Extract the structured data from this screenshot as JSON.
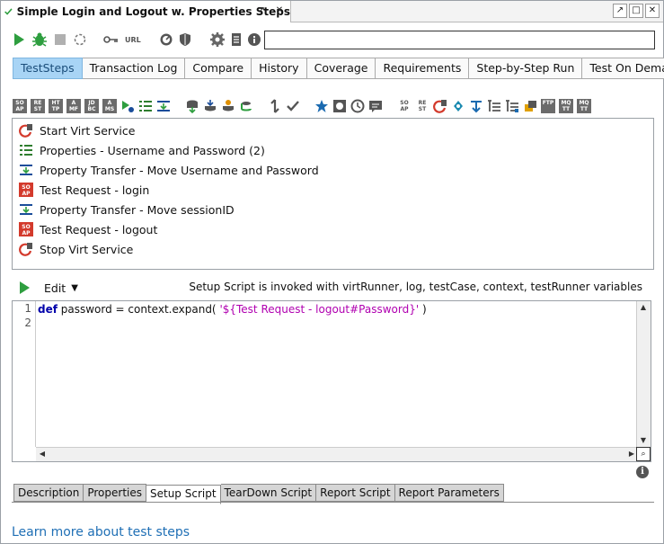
{
  "window": {
    "title": "Simple Login and Logout w. Properties Steps",
    "title_buttons": [
      "pin",
      "close"
    ],
    "window_buttons": [
      "pin",
      "restore",
      "close"
    ]
  },
  "toolbar": {
    "icons": [
      "run-icon",
      "debug-bug-icon",
      "stop-icon",
      "loop-icon",
      "key-icon",
      "url-icon",
      "gauge-icon",
      "shield-icon",
      "gear-icon",
      "list-icon",
      "info-icon"
    ],
    "url_label": "URL",
    "search_value": ""
  },
  "tabs": [
    {
      "label": "TestSteps",
      "active": true
    },
    {
      "label": "Transaction Log"
    },
    {
      "label": "Compare"
    },
    {
      "label": "History"
    },
    {
      "label": "Coverage"
    },
    {
      "label": "Requirements"
    },
    {
      "label": "Step-by-Step Run"
    },
    {
      "label": "Test On Demand"
    }
  ],
  "step_toolbar": {
    "square_labels": [
      "SO AP",
      "RE ST",
      "HT TP",
      "A MF",
      "JD BC",
      "A MS"
    ],
    "right_square_labels": [
      "FTP",
      "MQ TT",
      "MQ TT"
    ]
  },
  "steps": [
    {
      "label": "Start Virt Service",
      "icon": "virt-service-icon"
    },
    {
      "label": "Properties - Username and Password (2)",
      "icon": "properties-icon"
    },
    {
      "label": "Property Transfer - Move Username and Password",
      "icon": "property-transfer-icon"
    },
    {
      "label": "Test Request - login",
      "icon": "soap-request-icon"
    },
    {
      "label": "Property Transfer - Move sessionID",
      "icon": "property-transfer-icon"
    },
    {
      "label": "Test Request - logout",
      "icon": "soap-request-icon"
    },
    {
      "label": "Stop Virt Service",
      "icon": "virt-service-icon"
    }
  ],
  "script": {
    "edit_label": "Edit",
    "hint": "Setup Script is invoked with virtRunner, log, testCase, context, testRunner variables",
    "line_numbers": [
      "1",
      "2"
    ],
    "code_keyword": "def",
    "code_plain": " password = context.expand( ",
    "code_string": "'${Test Request - logout#Password}'",
    "code_end": " )"
  },
  "bottom_tabs": [
    {
      "label": "Description"
    },
    {
      "label": "Properties"
    },
    {
      "label": "Setup Script",
      "active": true
    },
    {
      "label": "TearDown Script"
    },
    {
      "label": "Report Script"
    },
    {
      "label": "Report Parameters"
    }
  ],
  "learn_more": "Learn more about test steps",
  "colors": {
    "active_tab": "#a8d4f5",
    "link": "#1f6fb5",
    "run_green": "#2e9e3f",
    "soap_red": "#d33a2c"
  }
}
